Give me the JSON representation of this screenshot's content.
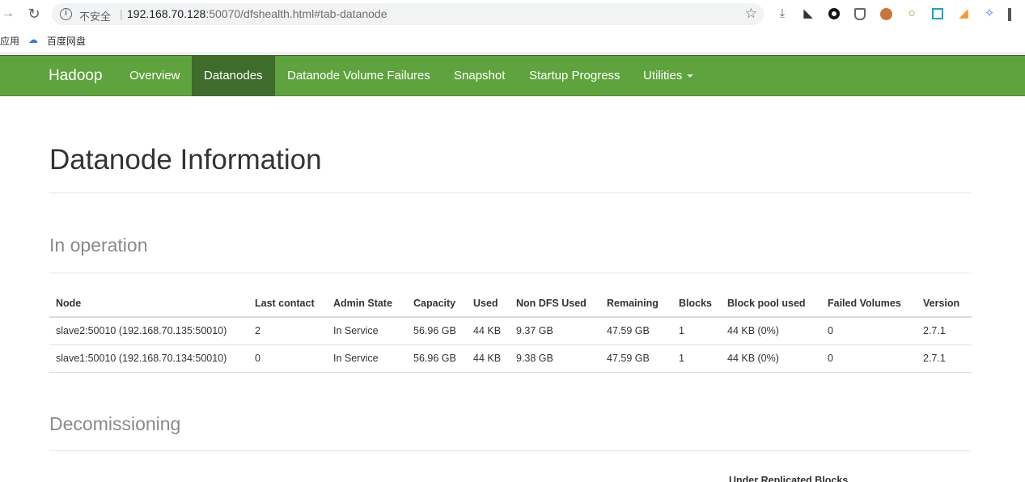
{
  "browser": {
    "insecure_label": "不安全",
    "url_host": "192.168.70.128",
    "url_rest": ":50070/dfshealth.html#tab-datanode",
    "bookmark_apps": "应用",
    "bookmark_baidu": "百度网盘"
  },
  "navbar": {
    "brand": "Hadoop",
    "items": [
      {
        "label": "Overview"
      },
      {
        "label": "Datanodes"
      },
      {
        "label": "Datanode Volume Failures"
      },
      {
        "label": "Snapshot"
      },
      {
        "label": "Startup Progress"
      },
      {
        "label": "Utilities"
      }
    ]
  },
  "page": {
    "title": "Datanode Information",
    "in_operation": "In operation",
    "decomissioning": "Decomissioning",
    "under_replicated": "Under Replicated Blocks"
  },
  "table": {
    "headers": [
      "Node",
      "Last contact",
      "Admin State",
      "Capacity",
      "Used",
      "Non DFS Used",
      "Remaining",
      "Blocks",
      "Block pool used",
      "Failed Volumes",
      "Version"
    ],
    "rows": [
      [
        "slave2:50010 (192.168.70.135:50010)",
        "2",
        "In Service",
        "56.96 GB",
        "44 KB",
        "9.37 GB",
        "47.59 GB",
        "1",
        "44 KB (0%)",
        "0",
        "2.7.1"
      ],
      [
        "slave1:50010 (192.168.70.134:50010)",
        "0",
        "In Service",
        "56.96 GB",
        "44 KB",
        "9.38 GB",
        "47.59 GB",
        "1",
        "44 KB (0%)",
        "0",
        "2.7.1"
      ]
    ]
  }
}
